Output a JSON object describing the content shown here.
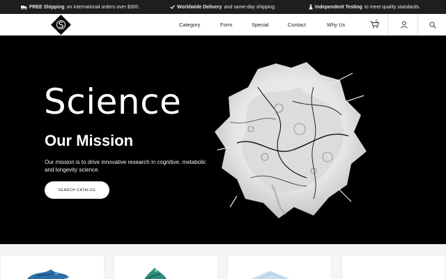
{
  "announcements": [
    {
      "bold": "FREE Shipping",
      "text": "on international orders over $300.",
      "icon": "truck-icon"
    },
    {
      "bold": "Worldwide Delivery",
      "text": "and same-day shipping.",
      "icon": "check-icon"
    },
    {
      "bold": "Independent Testing",
      "text": "to meet quality standards.",
      "icon": "flask-icon"
    }
  ],
  "header": {
    "logo_letter": "S",
    "nav": [
      "Category",
      "Form",
      "Special",
      "Contact",
      "Why Us"
    ],
    "cart_count": "0",
    "icons": [
      "cart-icon",
      "user-icon",
      "search-icon"
    ]
  },
  "hero": {
    "title": "Science",
    "subtitle": "Our Mission",
    "description": "Our mission is to drive innovative research in cognitive, metabolic and longevity science.",
    "button_label": "SEARCH CATALOG"
  },
  "colors": {
    "topbar_bg": "#1e1e1e",
    "hero_bg": "#000000",
    "header_bg": "#ffffff"
  }
}
